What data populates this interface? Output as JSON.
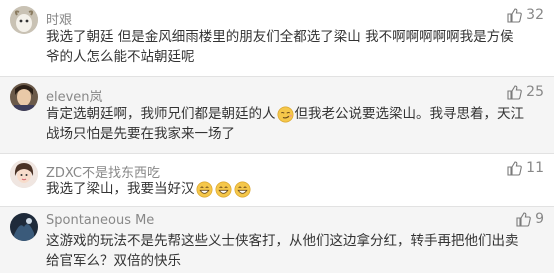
{
  "comments": [
    {
      "username": "时艰",
      "likes": "32",
      "text": "我选了朝廷 但是金风细雨楼里的朋友们全都选了梁山 我不啊啊啊啊啊我是方侯爷的人怎么能不站朝廷呢",
      "avatar_icon": "goat-avatar",
      "thumb_icon": "thumbs-up-icon"
    },
    {
      "username": "eleven岚",
      "likes": "25",
      "text_before_emoji": "肯定选朝廷啊，我师兄们都是朝廷的人",
      "text_after_emoji": "但我老公说要选梁山。我寻思着，天江战场只怕是先要在我家来一场了",
      "emoji_icon": "smirk-emoji",
      "avatar_icon": "portrait-avatar",
      "thumb_icon": "thumbs-up-icon"
    },
    {
      "username": "ZDXC不是找东西吃",
      "likes": "11",
      "text": "我选了梁山，我要当好汉",
      "emoji_icons": [
        "grin-emoji",
        "grin-emoji",
        "grin-emoji"
      ],
      "avatar_icon": "girl-avatar",
      "thumb_icon": "thumbs-up-icon"
    },
    {
      "username": "Spontaneous Me",
      "likes": "9",
      "text": "这游戏的玩法不是先帮这些义士侠客打，从他们这边拿分红，转手再把他们出卖给官军么？双倍的快乐",
      "avatar_icon": "dark-avatar",
      "thumb_icon": "thumbs-up-icon"
    }
  ]
}
